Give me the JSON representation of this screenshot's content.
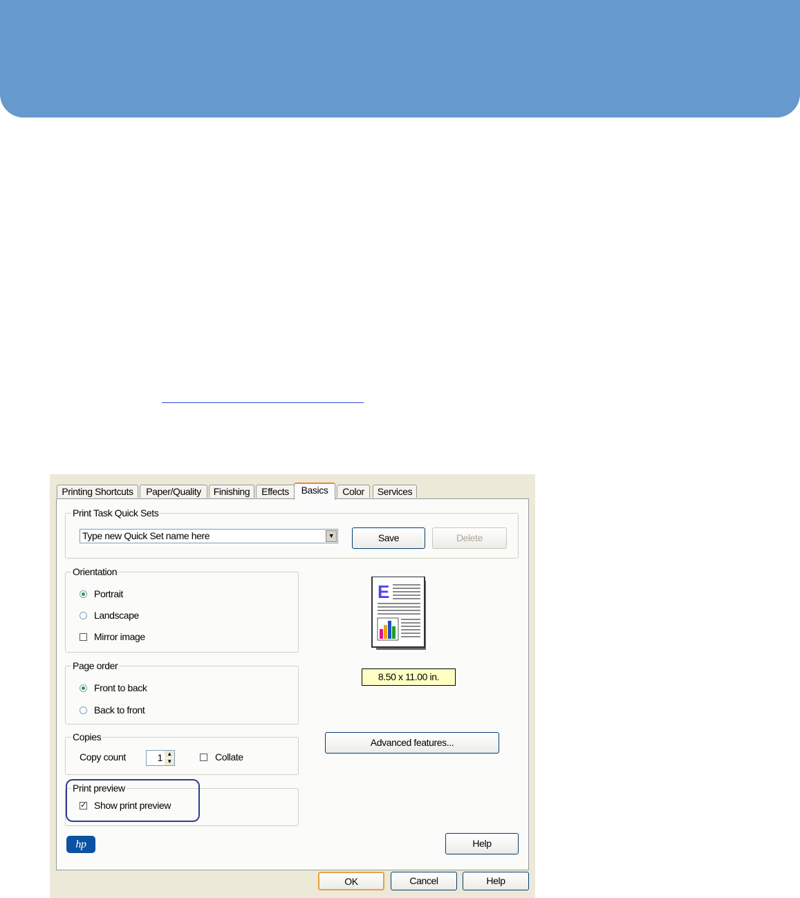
{
  "colors": {
    "banner": "#6699cc",
    "dialog_bg": "#ece9d8",
    "active_tab": "#e68b2c",
    "highlight": "#2f3c8f",
    "size_box": "#ffffc4"
  },
  "tabs": [
    {
      "label": "Printing Shortcuts"
    },
    {
      "label": "Paper/Quality"
    },
    {
      "label": "Finishing"
    },
    {
      "label": "Effects"
    },
    {
      "label": "Basics"
    },
    {
      "label": "Color"
    },
    {
      "label": "Services"
    }
  ],
  "active_tab": "Basics",
  "quick_sets": {
    "group_label": "Print Task Quick Sets",
    "combo_value": "Type new Quick Set name here",
    "save_label": "Save",
    "delete_label": "Delete"
  },
  "orientation": {
    "group_label": "Orientation",
    "portrait": "Portrait",
    "landscape": "Landscape",
    "mirror": "Mirror image",
    "selected": "Portrait",
    "mirror_checked": false
  },
  "page_order": {
    "group_label": "Page order",
    "front_to_back": "Front to back",
    "back_to_front": "Back to front",
    "selected": "Front to back"
  },
  "copies": {
    "group_label": "Copies",
    "count_label": "Copy count",
    "count_value": "1",
    "collate": "Collate",
    "collate_checked": false
  },
  "print_preview": {
    "group_label": "Print preview",
    "show_label": "Show print preview",
    "checked": true
  },
  "paper_size": "8.50 x 11.00 in.",
  "advanced_label": "Advanced features...",
  "help_label": "Help",
  "footer": {
    "ok": "OK",
    "cancel": "Cancel",
    "help": "Help"
  },
  "icons": {
    "logo": "hp-logo",
    "preview": "page-preview-icon"
  }
}
